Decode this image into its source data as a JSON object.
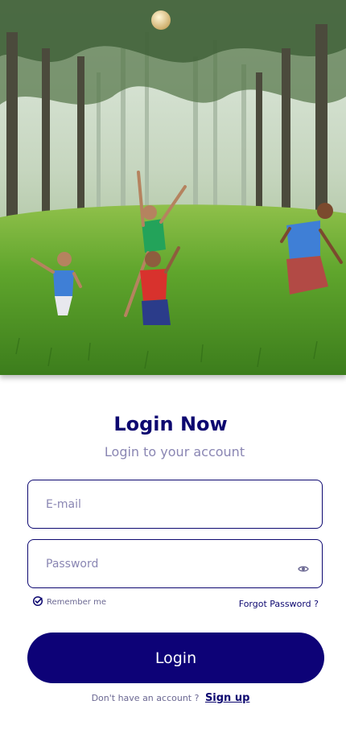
{
  "hero": {
    "image": "children-playing-ball-in-forest-photo"
  },
  "header": {
    "title": "Login Now",
    "subtitle": "Login to your account"
  },
  "form": {
    "email": {
      "value": "",
      "placeholder": "E-mail"
    },
    "password": {
      "value": "",
      "placeholder": "Password",
      "toggle_icon": "eye-icon"
    },
    "remember_label": "Remember me",
    "remember_checked": true,
    "forgot_label": "Forgot Password ?",
    "submit_label": "Login"
  },
  "footer": {
    "prompt": "Don't have an account ?",
    "signup_label": "Sign up"
  },
  "colors": {
    "primary": "#0d0277",
    "title": "#0d0870",
    "muted": "#8a86b3"
  }
}
